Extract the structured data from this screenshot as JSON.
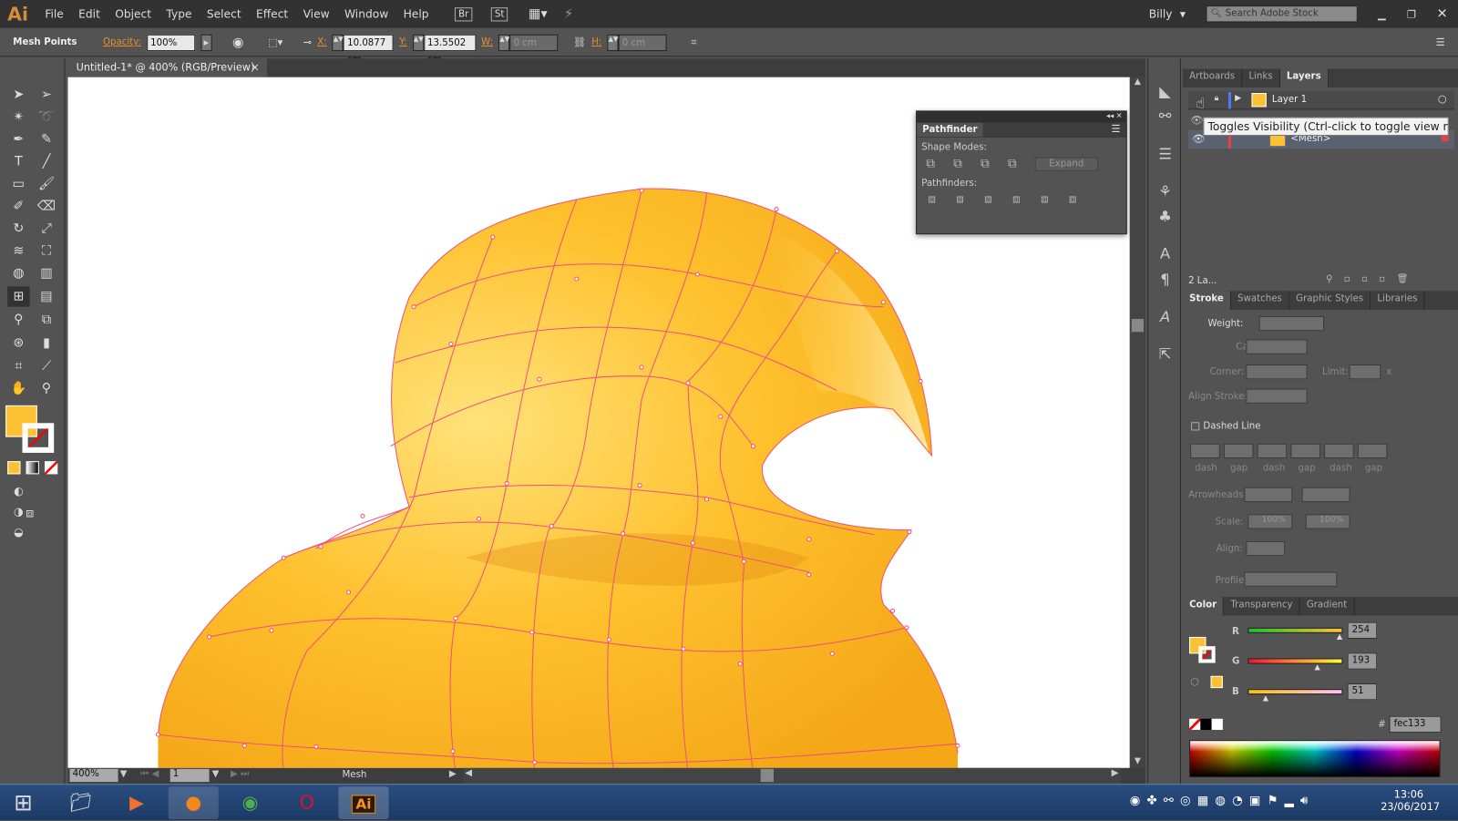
{
  "app": {
    "logo": "Ai",
    "menus": [
      "File",
      "Edit",
      "Object",
      "Type",
      "Select",
      "Effect",
      "View",
      "Window",
      "Help"
    ],
    "bridge": "Br",
    "stock": "St",
    "user": "Billy",
    "search_placeholder": "Search Adobe Stock"
  },
  "control": {
    "mode": "Mesh Points",
    "opacity_label": "Opacity:",
    "opacity": "100%",
    "x_label": "X:",
    "x": "10.0877 cm",
    "y_label": "Y:",
    "y": "13.5502 cm",
    "w_label": "W:",
    "w": "0 cm",
    "h_label": "H:",
    "h": "0 cm"
  },
  "document": {
    "tab": "Untitled-1* @ 400% (RGB/Preview)",
    "close": "×"
  },
  "status": {
    "zoom": "400%",
    "page": "1",
    "tool": "Mesh"
  },
  "pathfinder": {
    "title": "Pathfinder",
    "shape_modes": "Shape Modes:",
    "expand": "Expand",
    "pathfinders": "Pathfinders:"
  },
  "layers": {
    "tabs": [
      "Artboards",
      "Links",
      "Layers"
    ],
    "layer1": "Layer 1",
    "mesh": "<Mesh>",
    "footer": "2 La...",
    "tooltip": "Toggles Visibility (Ctrl-click to toggle view mode)"
  },
  "stroke": {
    "tabs": [
      "Stroke",
      "Swatches",
      "Graphic Styles",
      "Libraries"
    ],
    "weight": "Weight:",
    "cap": "Cap:",
    "corner": "Corner:",
    "limit": "Limit:",
    "limit_unit": "x",
    "align": "Align Stroke:",
    "dashed": "Dashed Line",
    "dash_labels": [
      "dash",
      "gap",
      "dash",
      "gap",
      "dash",
      "gap"
    ],
    "arrowheads": "Arrowheads:",
    "scale": "Scale:",
    "scale1": "100%",
    "scale2": "100%",
    "align2": "Align:",
    "profile": "Profile:"
  },
  "color": {
    "tabs": [
      "Color",
      "Transparency",
      "Gradient"
    ],
    "r_label": "R",
    "r": 254,
    "g_label": "G",
    "g": 193,
    "b_label": "B",
    "b": 51,
    "hash": "#",
    "hex": "fec133",
    "fill": "#fec133"
  },
  "taskbar": {
    "time": "13:06",
    "date": "23/06/2017",
    "ai": "Ai"
  }
}
